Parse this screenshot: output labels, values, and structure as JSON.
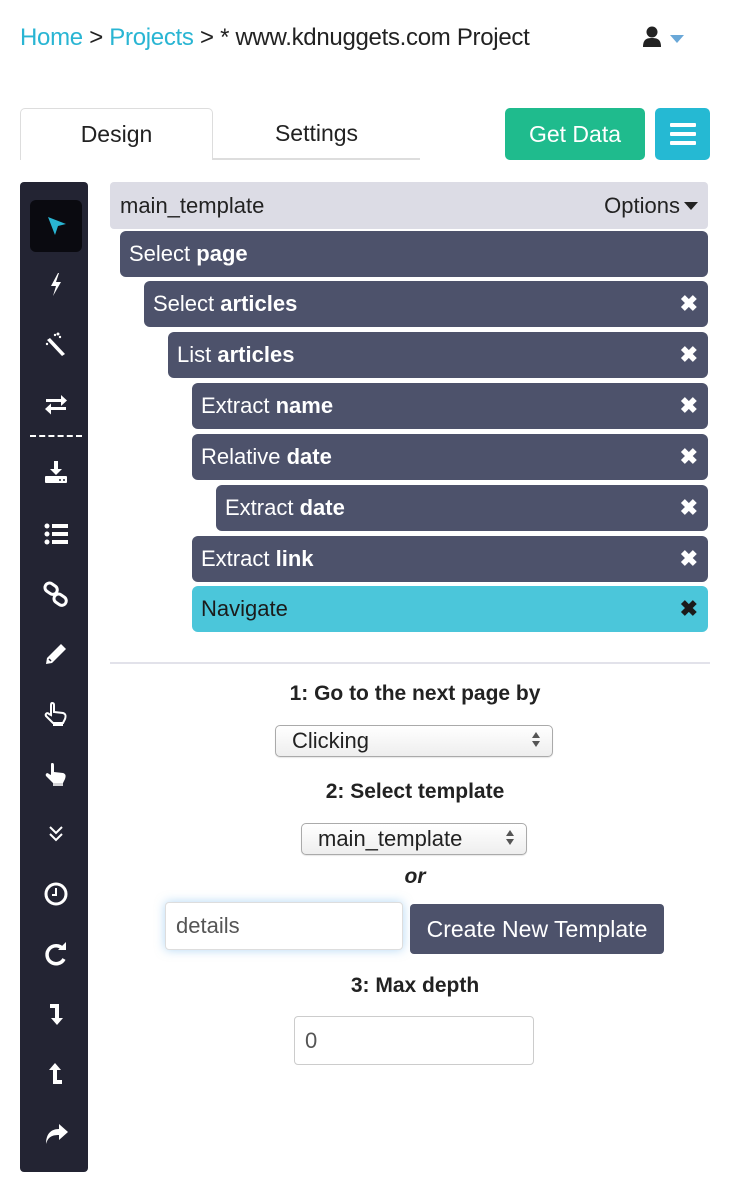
{
  "breadcrumb": {
    "home": "Home",
    "projects": "Projects",
    "separator": ">",
    "current": "* www.kdnuggets.com Project"
  },
  "user_menu": {
    "icon": "user-icon"
  },
  "tabs": [
    {
      "label": "Design",
      "active": true
    },
    {
      "label": "Settings",
      "active": false
    }
  ],
  "actions": {
    "get_data": "Get Data",
    "menu_icon": "hamburger-icon"
  },
  "toolbar": {
    "tools": [
      {
        "icon": "pointer-icon",
        "active": true
      },
      {
        "icon": "bolt-icon"
      },
      {
        "icon": "magic-wand-icon"
      },
      {
        "icon": "exchange-icon"
      },
      {
        "icon": "download-icon"
      },
      {
        "icon": "list-icon"
      },
      {
        "icon": "link-icon"
      },
      {
        "icon": "pencil-icon"
      },
      {
        "icon": "hand-pointer-icon"
      },
      {
        "icon": "hand-click-icon"
      },
      {
        "icon": "double-chevron-down-icon"
      },
      {
        "icon": "clock-icon"
      },
      {
        "icon": "refresh-icon"
      },
      {
        "icon": "level-down-icon"
      },
      {
        "icon": "level-up-icon"
      },
      {
        "icon": "share-icon"
      }
    ]
  },
  "template": {
    "name": "main_template",
    "options_label": "Options"
  },
  "nodes": [
    {
      "verb": "Select",
      "target": "page",
      "closable": false,
      "active": false
    },
    {
      "verb": "Select",
      "target": "articles",
      "closable": true,
      "active": false
    },
    {
      "verb": "List",
      "target": "articles",
      "closable": true,
      "active": false
    },
    {
      "verb": "Extract",
      "target": "name",
      "closable": true,
      "active": false
    },
    {
      "verb": "Relative",
      "target": "date",
      "closable": true,
      "active": false
    },
    {
      "verb": "Extract",
      "target": "date",
      "closable": true,
      "active": false
    },
    {
      "verb": "Extract",
      "target": "link",
      "closable": true,
      "active": false
    },
    {
      "verb": "Navigate",
      "target": "",
      "closable": true,
      "active": true
    }
  ],
  "close_glyph": "✖",
  "navigate_settings": {
    "step1_label": "1: Go to the next page by",
    "step1_value": "Clicking",
    "step2_label": "2: Select template",
    "step2_value": "main_template",
    "or_label": "or",
    "new_template_value": "details",
    "create_button": "Create New Template",
    "step3_label": "3: Max depth",
    "max_depth_value": "0"
  }
}
